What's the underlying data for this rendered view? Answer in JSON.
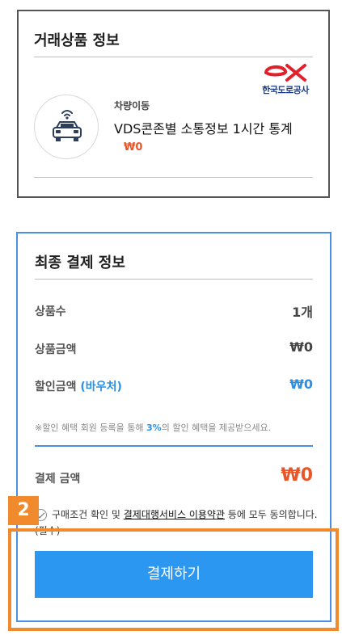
{
  "product_section": {
    "title": "거래상품 정보",
    "provider_logo_text": "한국도로공사",
    "category": "차량이동",
    "product_name": "VDS콘존별 소통정보 1시간 통계",
    "price": "₩0"
  },
  "payment_section": {
    "title": "최종 결제 정보",
    "rows": [
      {
        "label": "상품수",
        "value": "1개"
      },
      {
        "label": "상품금액",
        "value": "₩0"
      },
      {
        "label": "할인금액",
        "label_suffix": "(바우처)",
        "value": "₩0"
      }
    ],
    "notice_prefix": "※할인 혜택 회원 등록을 통해 ",
    "notice_pct": "3%",
    "notice_suffix": "의 할인 혜택을 제공받으세요.",
    "total_label": "결제 금액",
    "total_value": "₩0",
    "agree_prefix": "구매조건 확인 및 ",
    "agree_link": "결제대행서비스 이용약관",
    "agree_suffix": " 등에 모두 동의합니다.(필수)",
    "pay_button": "결제하기"
  },
  "annotation": {
    "step_number": "2"
  },
  "colors": {
    "accent_blue": "#2b97f1",
    "price_orange": "#e8572a",
    "highlight_orange": "#f08a2c"
  }
}
